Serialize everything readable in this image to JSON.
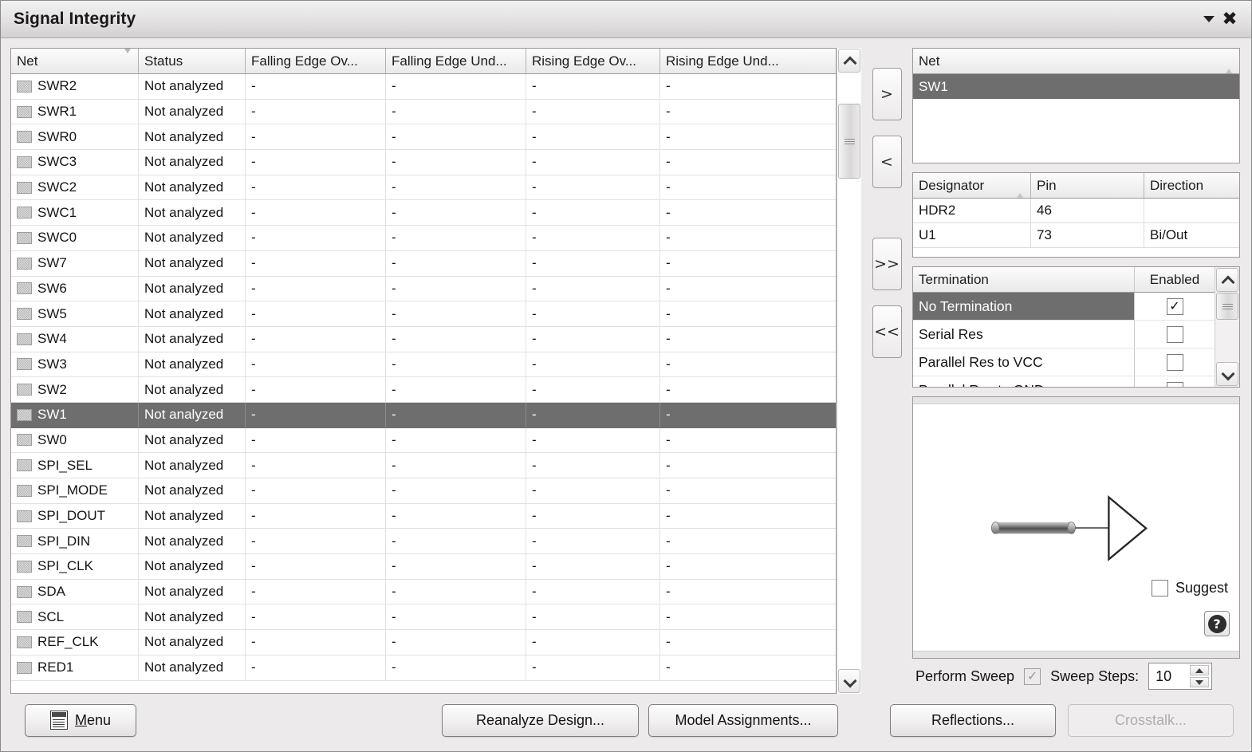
{
  "window": {
    "title": "Signal Integrity",
    "minimize_icon": "chevron-down-icon",
    "close_icon": "close-icon"
  },
  "net_grid": {
    "columns": [
      {
        "label": "Net",
        "sort": "descending"
      },
      {
        "label": "Status",
        "sort": "none"
      },
      {
        "label": "Falling Edge Ov...",
        "sort": "none"
      },
      {
        "label": "Falling Edge Und...",
        "sort": "none"
      },
      {
        "label": "Rising Edge Ov...",
        "sort": "none"
      },
      {
        "label": "Rising Edge Und...",
        "sort": "none"
      }
    ],
    "rows": [
      {
        "net": "SWR2",
        "status": "Not analyzed",
        "fov": "-",
        "fun": "-",
        "rov": "-",
        "run": "-",
        "selected": false
      },
      {
        "net": "SWR1",
        "status": "Not analyzed",
        "fov": "-",
        "fun": "-",
        "rov": "-",
        "run": "-",
        "selected": false
      },
      {
        "net": "SWR0",
        "status": "Not analyzed",
        "fov": "-",
        "fun": "-",
        "rov": "-",
        "run": "-",
        "selected": false
      },
      {
        "net": "SWC3",
        "status": "Not analyzed",
        "fov": "-",
        "fun": "-",
        "rov": "-",
        "run": "-",
        "selected": false
      },
      {
        "net": "SWC2",
        "status": "Not analyzed",
        "fov": "-",
        "fun": "-",
        "rov": "-",
        "run": "-",
        "selected": false
      },
      {
        "net": "SWC1",
        "status": "Not analyzed",
        "fov": "-",
        "fun": "-",
        "rov": "-",
        "run": "-",
        "selected": false
      },
      {
        "net": "SWC0",
        "status": "Not analyzed",
        "fov": "-",
        "fun": "-",
        "rov": "-",
        "run": "-",
        "selected": false
      },
      {
        "net": "SW7",
        "status": "Not analyzed",
        "fov": "-",
        "fun": "-",
        "rov": "-",
        "run": "-",
        "selected": false
      },
      {
        "net": "SW6",
        "status": "Not analyzed",
        "fov": "-",
        "fun": "-",
        "rov": "-",
        "run": "-",
        "selected": false
      },
      {
        "net": "SW5",
        "status": "Not analyzed",
        "fov": "-",
        "fun": "-",
        "rov": "-",
        "run": "-",
        "selected": false
      },
      {
        "net": "SW4",
        "status": "Not analyzed",
        "fov": "-",
        "fun": "-",
        "rov": "-",
        "run": "-",
        "selected": false
      },
      {
        "net": "SW3",
        "status": "Not analyzed",
        "fov": "-",
        "fun": "-",
        "rov": "-",
        "run": "-",
        "selected": false
      },
      {
        "net": "SW2",
        "status": "Not analyzed",
        "fov": "-",
        "fun": "-",
        "rov": "-",
        "run": "-",
        "selected": false
      },
      {
        "net": "SW1",
        "status": "Not analyzed",
        "fov": "-",
        "fun": "-",
        "rov": "-",
        "run": "-",
        "selected": true
      },
      {
        "net": "SW0",
        "status": "Not analyzed",
        "fov": "-",
        "fun": "-",
        "rov": "-",
        "run": "-",
        "selected": false
      },
      {
        "net": "SPI_SEL",
        "status": "Not analyzed",
        "fov": "-",
        "fun": "-",
        "rov": "-",
        "run": "-",
        "selected": false
      },
      {
        "net": "SPI_MODE",
        "status": "Not analyzed",
        "fov": "-",
        "fun": "-",
        "rov": "-",
        "run": "-",
        "selected": false
      },
      {
        "net": "SPI_DOUT",
        "status": "Not analyzed",
        "fov": "-",
        "fun": "-",
        "rov": "-",
        "run": "-",
        "selected": false
      },
      {
        "net": "SPI_DIN",
        "status": "Not analyzed",
        "fov": "-",
        "fun": "-",
        "rov": "-",
        "run": "-",
        "selected": false
      },
      {
        "net": "SPI_CLK",
        "status": "Not analyzed",
        "fov": "-",
        "fun": "-",
        "rov": "-",
        "run": "-",
        "selected": false
      },
      {
        "net": "SDA",
        "status": "Not analyzed",
        "fov": "-",
        "fun": "-",
        "rov": "-",
        "run": "-",
        "selected": false
      },
      {
        "net": "SCL",
        "status": "Not analyzed",
        "fov": "-",
        "fun": "-",
        "rov": "-",
        "run": "-",
        "selected": false
      },
      {
        "net": "REF_CLK",
        "status": "Not analyzed",
        "fov": "-",
        "fun": "-",
        "rov": "-",
        "run": "-",
        "selected": false
      },
      {
        "net": "RED1",
        "status": "Not analyzed",
        "fov": "-",
        "fun": "-",
        "rov": "-",
        "run": "-",
        "selected": false
      }
    ]
  },
  "transfer_buttons": [
    {
      "label": ">",
      "name": "move-right-button"
    },
    {
      "label": "<",
      "name": "move-left-button"
    },
    {
      "label": ">>",
      "name": "move-all-right-button"
    },
    {
      "label": "<<",
      "name": "move-all-left-button"
    }
  ],
  "selected_nets": {
    "header": {
      "label": "Net",
      "sort": "ascending"
    },
    "rows": [
      {
        "net": "SW1",
        "selected": true
      }
    ]
  },
  "pins": {
    "columns": [
      "Designator",
      "Pin",
      "Direction"
    ],
    "sort_column": "Designator",
    "sort": "ascending",
    "rows": [
      {
        "designator": "HDR2",
        "pin": "46",
        "direction": ""
      },
      {
        "designator": "U1",
        "pin": "73",
        "direction": "Bi/Out"
      }
    ]
  },
  "termination": {
    "columns": [
      "Termination",
      "Enabled"
    ],
    "rows": [
      {
        "name": "No Termination",
        "enabled": true,
        "selected": true
      },
      {
        "name": "Serial Res",
        "enabled": false,
        "selected": false
      },
      {
        "name": "Parallel Res to VCC",
        "enabled": false,
        "selected": false
      },
      {
        "name": "Parallel Res to GND",
        "enabled": false,
        "selected": false
      }
    ]
  },
  "preview": {
    "suggest_label": "Suggest",
    "suggest_checked": false,
    "help_glyph": "?",
    "diagram": "resistor-to-buffer-schematic"
  },
  "sweep": {
    "perform_label": "Perform Sweep",
    "perform_checked": true,
    "perform_enabled": false,
    "steps_label": "Sweep Steps:",
    "steps_value": "10"
  },
  "footer": {
    "menu_label_pre": "",
    "menu_label_accel": "M",
    "menu_label_post": "enu",
    "reanalyze_label": "Reanalyze Design...",
    "model_label": "Model Assignments...",
    "reflections_label": "Reflections...",
    "crosstalk_label": "Crosstalk...",
    "crosstalk_enabled": false
  },
  "colors": {
    "selection": "#6e6e6e",
    "panel_bg": "#eceaea",
    "grid_bg": "#ffffff",
    "border": "#9a9a9a",
    "disabled_text": "#aeaeae"
  }
}
